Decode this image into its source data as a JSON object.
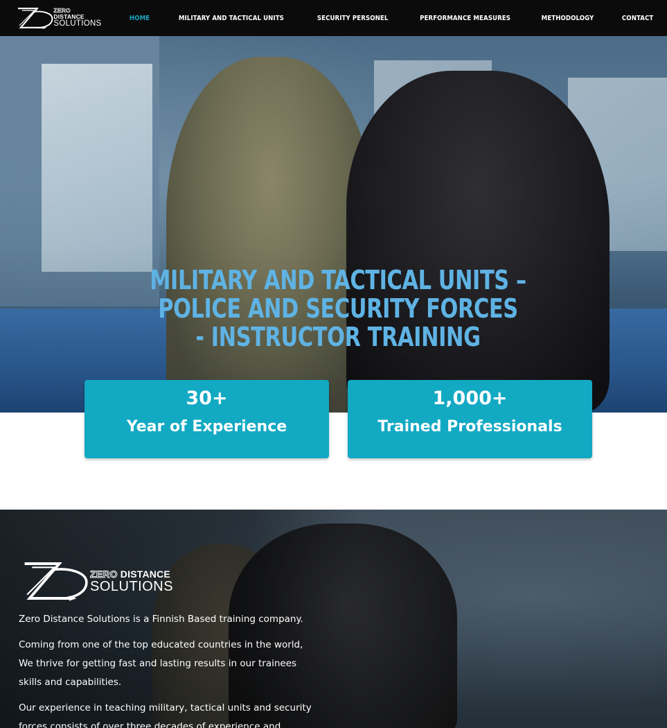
{
  "brand": {
    "line1_outline": "ZERO",
    "line1_solid": "DISTANCE",
    "line2": "SOLUTIONS"
  },
  "nav": {
    "items": [
      {
        "label": "HOME",
        "active": true
      },
      {
        "label": "MILITARY AND TACTICAL UNITS",
        "active": false
      },
      {
        "label": "SECURITY PERSONEL",
        "active": false
      },
      {
        "label": "PERFORMANCE MEASURES",
        "active": false
      },
      {
        "label": "METHODOLOGY",
        "active": false
      },
      {
        "label": "CONTACT",
        "active": false
      }
    ]
  },
  "hero": {
    "title_line1": "MILITARY AND TACTICAL UNITS – POLICE AND SECURITY FORCES",
    "title_line2": "- INSTRUCTOR TRAINING"
  },
  "stats": [
    {
      "number": "30+",
      "label": "Year of Experience"
    },
    {
      "number": "1,000+",
      "label": "Trained Professionals"
    }
  ],
  "about": {
    "paragraphs": [
      "Zero Distance Solutions is a Finnish Based training company.",
      "Coming from one of the top educated countries in the world, We thrive for getting fast and lasting results in our trainees skills and capabilities.",
      "Our experience in teaching military, tactical units and security forces consists of over three decades of experience and"
    ]
  },
  "colors": {
    "accent": "#12a9c3",
    "nav_active": "#1aa7c2",
    "hero_title": "#5fb3e4",
    "nav_bg": "#0b0b0c"
  }
}
